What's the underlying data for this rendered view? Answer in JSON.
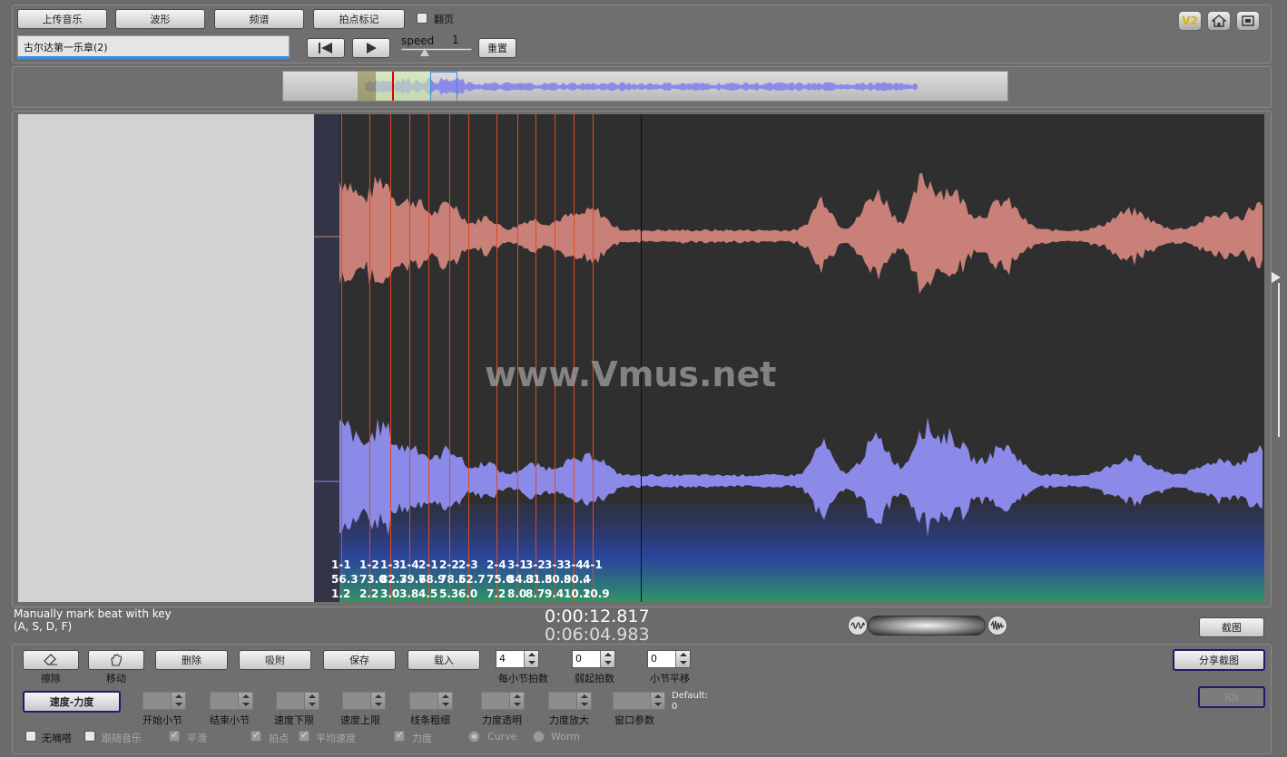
{
  "toolbar": {
    "upload_label": "上传音乐",
    "waveform_label": "波形",
    "spectrum_label": "频谱",
    "beatmark_label": "拍点标记",
    "pageflip_label": "翻页",
    "track_name": "古尔达第一乐章(2)",
    "speed_label": "speed",
    "speed_value": "1",
    "reset_label": "重置",
    "v2_label": "V2"
  },
  "overlay": {
    "watermark": "www.Vmus.net"
  },
  "beats": [
    {
      "id": "1-1",
      "tempo": "56.3",
      "time": "1.2"
    },
    {
      "id": "1-2",
      "tempo": "73.0",
      "time": "2.2"
    },
    {
      "id": "1-3",
      "tempo": "82.3",
      "time": "3.0"
    },
    {
      "id": "1-4",
      "tempo": "79.6",
      "time": "3.8"
    },
    {
      "id": "2-1",
      "tempo": "78.9",
      "time": "4.5"
    },
    {
      "id": "2-2",
      "tempo": "78.6",
      "time": "5.3"
    },
    {
      "id": "2-3",
      "tempo": "52.7",
      "time": "6.0"
    },
    {
      "id": "2-4",
      "tempo": "75.0",
      "time": "7.2"
    },
    {
      "id": "3-1",
      "tempo": "84.3",
      "time": "8.0"
    },
    {
      "id": "3-2",
      "tempo": "81.5",
      "time": "8.7"
    },
    {
      "id": "3-3",
      "tempo": "80.9",
      "time": "9.4"
    },
    {
      "id": "3-4",
      "tempo": "80.4",
      "time": "10.2"
    },
    {
      "id": "4-1",
      "tempo": ".-",
      "time": "10.9"
    }
  ],
  "status": {
    "hint_line1": "Manually mark beat with key",
    "hint_line2": "(A, S, D, F)",
    "current_time": "0:00:12.817",
    "total_time": "0:06:04.983",
    "screenshot_label": "截图"
  },
  "controls": {
    "erase_label": "擦除",
    "move_label": "移动",
    "delete_label": "删除",
    "snap_label": "吸附",
    "save_label": "保存",
    "load_label": "载入",
    "beats_per_bar_value": "4",
    "beats_per_bar_label": "每小节拍数",
    "pickup_value": "0",
    "pickup_label": "弱起拍数",
    "bar_shift_value": "0",
    "bar_shift_label": "小节平移",
    "share_label": "分享截图",
    "ioi_label": "IOI",
    "tempo_dynamics_label": "速度-力度",
    "start_bar_label": "开始小节",
    "end_bar_label": "结束小节",
    "tempo_low_label": "速度下限",
    "tempo_high_label": "速度上限",
    "line_width_label": "线条粗细",
    "dyn_alpha_label": "力度透明",
    "dyn_zoom_label": "力度放大",
    "window_param_label": "窗口参数",
    "default_label": "Default:",
    "default_value": "0",
    "no_click_label": "无嘀嗒",
    "follow_music_label": "跟随音乐",
    "smooth_label": "平滑",
    "beat_point_label": "拍点",
    "avg_tempo_label": "平均速度",
    "dynamics_label": "力度",
    "curve_label": "Curve",
    "worm_label": "Worm"
  },
  "colors": {
    "top_wave": "#c88078",
    "bottom_wave": "#8c8ae8",
    "beat_line": "#e04a1f",
    "canvas_bg": "#2f2f2f"
  }
}
